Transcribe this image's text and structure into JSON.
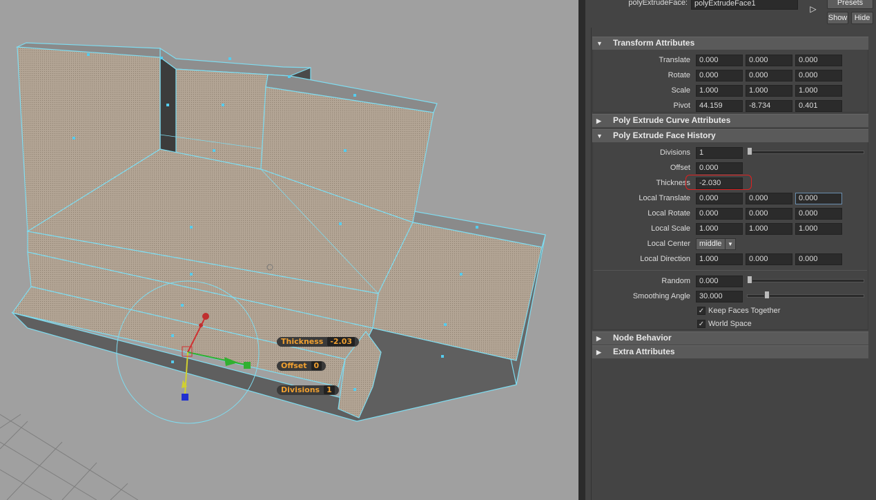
{
  "node": {
    "label": "polyExtrudeFace:",
    "value": "polyExtrudeFace1"
  },
  "buttons": {
    "presets": "Presets",
    "show": "Show",
    "hide": "Hide"
  },
  "sections": {
    "transform": "Transform Attributes",
    "curve": "Poly Extrude Curve Attributes",
    "history": "Poly Extrude Face History",
    "node_behavior": "Node Behavior",
    "extra": "Extra Attributes"
  },
  "transform": {
    "translate": {
      "label": "Translate",
      "v": [
        "0.000",
        "0.000",
        "0.000"
      ]
    },
    "rotate": {
      "label": "Rotate",
      "v": [
        "0.000",
        "0.000",
        "0.000"
      ]
    },
    "scale": {
      "label": "Scale",
      "v": [
        "1.000",
        "1.000",
        "1.000"
      ]
    },
    "pivot": {
      "label": "Pivot",
      "v": [
        "44.159",
        "-8.734",
        "0.401"
      ]
    }
  },
  "history": {
    "divisions": {
      "label": "Divisions",
      "v": "1",
      "slider": 0.0
    },
    "offset": {
      "label": "Offset",
      "v": "0.000"
    },
    "thickness": {
      "label": "Thickness",
      "v": "-2.030"
    },
    "local_translate": {
      "label": "Local Translate",
      "v": [
        "0.000",
        "0.000",
        "0.000"
      ]
    },
    "local_rotate": {
      "label": "Local Rotate",
      "v": [
        "0.000",
        "0.000",
        "0.000"
      ]
    },
    "local_scale": {
      "label": "Local Scale",
      "v": [
        "1.000",
        "1.000",
        "1.000"
      ]
    },
    "local_center": {
      "label": "Local Center",
      "v": "middle"
    },
    "local_direction": {
      "label": "Local Direction",
      "v": [
        "1.000",
        "0.000",
        "0.000"
      ]
    },
    "random": {
      "label": "Random",
      "v": "0.000",
      "slider": 0.0
    },
    "smoothing": {
      "label": "Smoothing Angle",
      "v": "30.000",
      "slider": 0.17
    },
    "keep_faces": {
      "label": "Keep Faces Together",
      "checked": true
    },
    "world_space": {
      "label": "World Space",
      "checked": true
    }
  },
  "hud": {
    "thickness": {
      "label": "Thickness",
      "v": "-2.03"
    },
    "offset": {
      "label": "Offset",
      "v": "0"
    },
    "divisions": {
      "label": "Divisions",
      "v": "1"
    }
  },
  "colors": {
    "wire": "#7fdcf0",
    "mesh": "#b2a494",
    "annotation": "#e02020"
  }
}
